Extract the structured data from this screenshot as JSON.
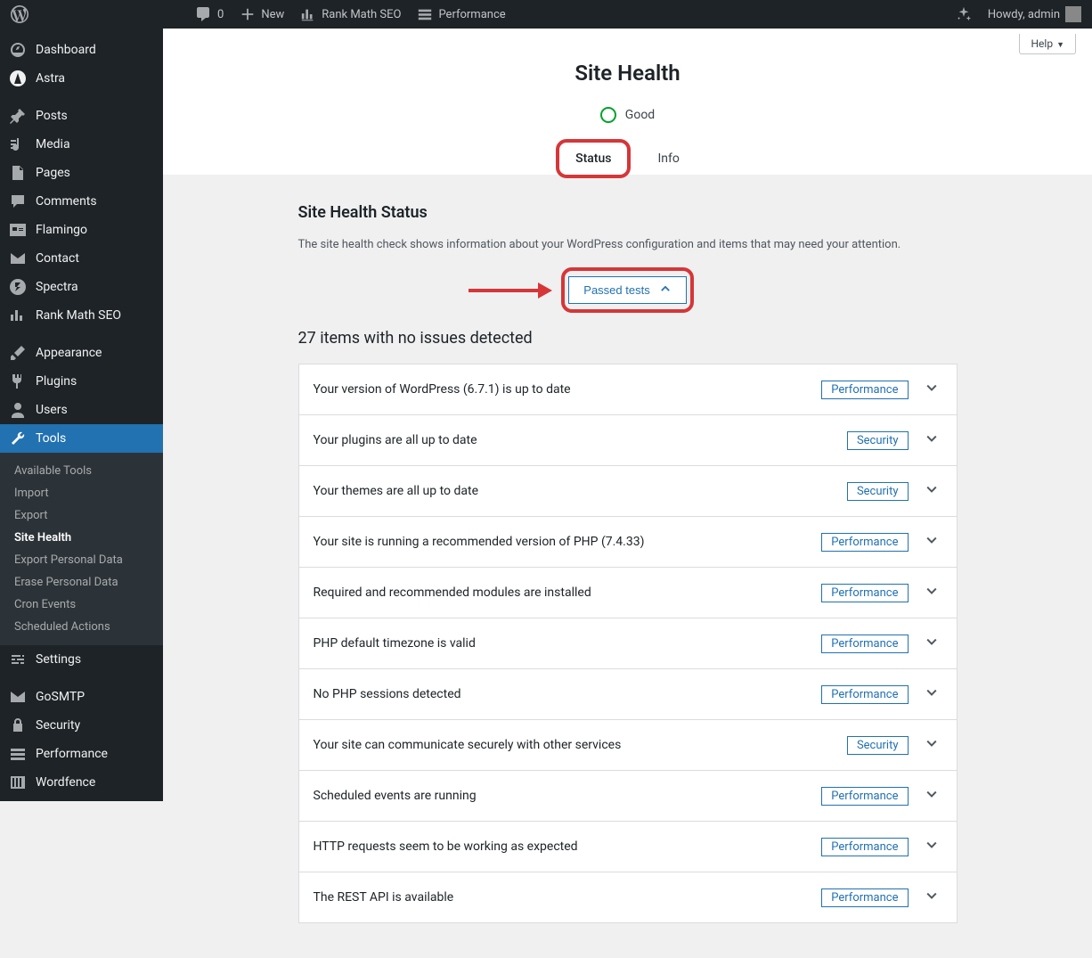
{
  "adminbar": {
    "comments_count": "0",
    "new_label": "New",
    "rankmath_label": "Rank Math SEO",
    "performance_label": "Performance",
    "howdy": "Howdy, admin"
  },
  "sidebar": {
    "items": [
      {
        "label": "Dashboard"
      },
      {
        "label": "Astra"
      },
      {
        "label": "Posts"
      },
      {
        "label": "Media"
      },
      {
        "label": "Pages"
      },
      {
        "label": "Comments"
      },
      {
        "label": "Flamingo"
      },
      {
        "label": "Contact"
      },
      {
        "label": "Spectra"
      },
      {
        "label": "Rank Math SEO"
      },
      {
        "label": "Appearance"
      },
      {
        "label": "Plugins"
      },
      {
        "label": "Users"
      },
      {
        "label": "Tools"
      },
      {
        "label": "Settings"
      },
      {
        "label": "GoSMTP"
      },
      {
        "label": "Security"
      },
      {
        "label": "Performance"
      },
      {
        "label": "Wordfence"
      }
    ],
    "submenu": [
      "Available Tools",
      "Import",
      "Export",
      "Site Health",
      "Export Personal Data",
      "Erase Personal Data",
      "Cron Events",
      "Scheduled Actions"
    ]
  },
  "header": {
    "help_label": "Help",
    "page_title": "Site Health",
    "status_label": "Good",
    "tabs": {
      "status": "Status",
      "info": "Info"
    }
  },
  "section": {
    "title": "Site Health Status",
    "description": "The site health check shows information about your WordPress configuration and items that may need your attention.",
    "passed_tests_label": "Passed tests",
    "items_count": "27",
    "items_heading": " items with no issues detected"
  },
  "badges": {
    "performance": "Performance",
    "security": "Security"
  },
  "tests": [
    {
      "title": "Your version of WordPress (6.7.1) is up to date",
      "badge": "performance"
    },
    {
      "title": "Your plugins are all up to date",
      "badge": "security"
    },
    {
      "title": "Your themes are all up to date",
      "badge": "security"
    },
    {
      "title": "Your site is running a recommended version of PHP (7.4.33)",
      "badge": "performance"
    },
    {
      "title": "Required and recommended modules are installed",
      "badge": "performance"
    },
    {
      "title": "PHP default timezone is valid",
      "badge": "performance"
    },
    {
      "title": "No PHP sessions detected",
      "badge": "performance"
    },
    {
      "title": "Your site can communicate securely with other services",
      "badge": "security"
    },
    {
      "title": "Scheduled events are running",
      "badge": "performance"
    },
    {
      "title": "HTTP requests seem to be working as expected",
      "badge": "performance"
    },
    {
      "title": "The REST API is available",
      "badge": "performance"
    }
  ]
}
